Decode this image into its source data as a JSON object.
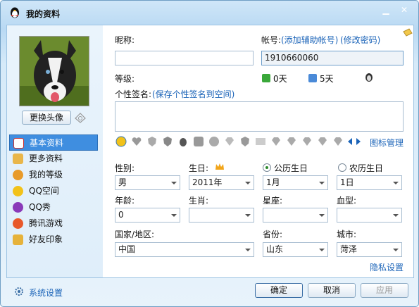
{
  "window": {
    "title": "我的资料",
    "minimize": "▁",
    "close": "✕"
  },
  "sidebar": {
    "change_avatar": "更换头像",
    "items": [
      {
        "label": "基本资料",
        "color": "#4a86c8"
      },
      {
        "label": "更多资料",
        "color": "#e0a030"
      },
      {
        "label": "我的等级",
        "color": "#d47a1a"
      },
      {
        "label": "QQ空间",
        "color": "#e8b010"
      },
      {
        "label": "QQ秀",
        "color": "#8a3ab9"
      },
      {
        "label": "腾讯游戏",
        "color": "#d43a2a"
      },
      {
        "label": "好友印象",
        "color": "#d4a020"
      }
    ],
    "settings": "系统设置"
  },
  "form": {
    "nickname_label": "昵称:",
    "nickname_value": "",
    "account_label": "帐号:",
    "account_add_link": "(添加辅助帐号)",
    "account_pwd_link": "(修改密码)",
    "account_value": "1910660060",
    "level_label": "等级:",
    "level_days_1": "0天",
    "level_days_2": "5天",
    "signature_label": "个性签名:",
    "signature_link": "(保存个性签名到空间)",
    "icon_manage": "图标管理",
    "gender_label": "性别:",
    "gender_value": "男",
    "birthday_label": "生日:",
    "birthday_year": "2011年",
    "lunar_radio_solar": "公历生日",
    "lunar_radio_lunar": "农历生日",
    "birth_month": "1月",
    "birth_day": "1日",
    "age_label": "年龄:",
    "age_value": "0",
    "zodiac_label": "生肖:",
    "zodiac_value": "",
    "constellation_label": "星座:",
    "constellation_value": "",
    "blood_label": "血型:",
    "blood_value": "",
    "country_label": "国家/地区:",
    "country_value": "中国",
    "province_label": "省份:",
    "province_value": "山东",
    "city_label": "城市:",
    "city_value": "菏泽",
    "privacy_link": "隐私设置"
  },
  "footer": {
    "ok": "确定",
    "cancel": "取消",
    "apply": "应用"
  }
}
